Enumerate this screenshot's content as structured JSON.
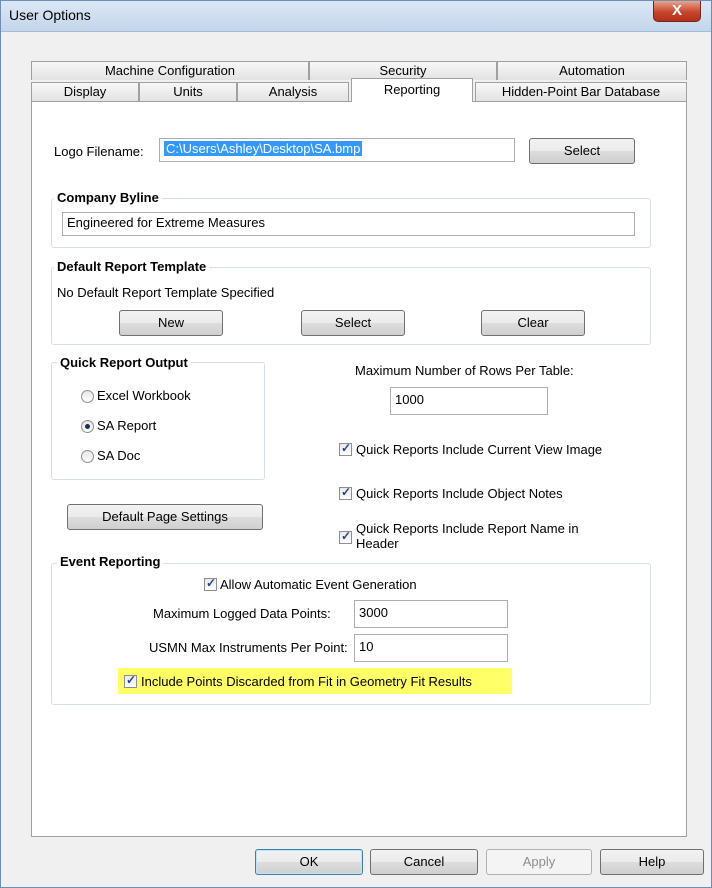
{
  "window": {
    "title": "User Options",
    "close_label": "X"
  },
  "tabs": {
    "row_back": [
      "Machine Configuration",
      "Security",
      "Automation"
    ],
    "row_front": [
      "Display",
      "Units",
      "Analysis",
      "Reporting",
      "Hidden-Point Bar Database"
    ],
    "active": "Reporting"
  },
  "logo": {
    "label": "Logo Filename:",
    "value": "C:\\Users\\Ashley\\Desktop\\SA.bmp",
    "select_label": "Select"
  },
  "company_byline": {
    "title": "Company Byline",
    "value": "Engineered for Extreme Measures"
  },
  "default_template": {
    "title": "Default Report Template",
    "status": "No Default Report Template Specified",
    "new_label": "New",
    "select_label": "Select",
    "clear_label": "Clear"
  },
  "quick_report": {
    "title": "Quick Report Output",
    "options": [
      "Excel Workbook",
      "SA Report",
      "SA Doc"
    ],
    "selected": "SA Report"
  },
  "max_rows": {
    "label": "Maximum Number of Rows Per Table:",
    "value": "1000"
  },
  "checkboxes": {
    "current_view": "Quick Reports Include Current View Image",
    "object_notes": "Quick Reports Include Object Notes",
    "report_name_line1": "Quick Reports Include Report Name in",
    "report_name_line2": "Header"
  },
  "default_page_settings_label": "Default Page Settings",
  "event_reporting": {
    "title": "Event Reporting",
    "allow_auto": "Allow Automatic Event Generation",
    "max_logged_label": "Maximum Logged Data Points:",
    "max_logged_value": "3000",
    "usmn_label": "USMN Max Instruments Per Point:",
    "usmn_value": "10",
    "include_discarded": "Include Points Discarded from Fit in Geometry Fit Results"
  },
  "footer": {
    "ok": "OK",
    "cancel": "Cancel",
    "apply": "Apply",
    "help": "Help"
  },
  "colors": {
    "highlight": "#ffff66",
    "selection": "#3399ff",
    "title_bar": "#c4d6ec",
    "close_button": "#c7462c"
  }
}
